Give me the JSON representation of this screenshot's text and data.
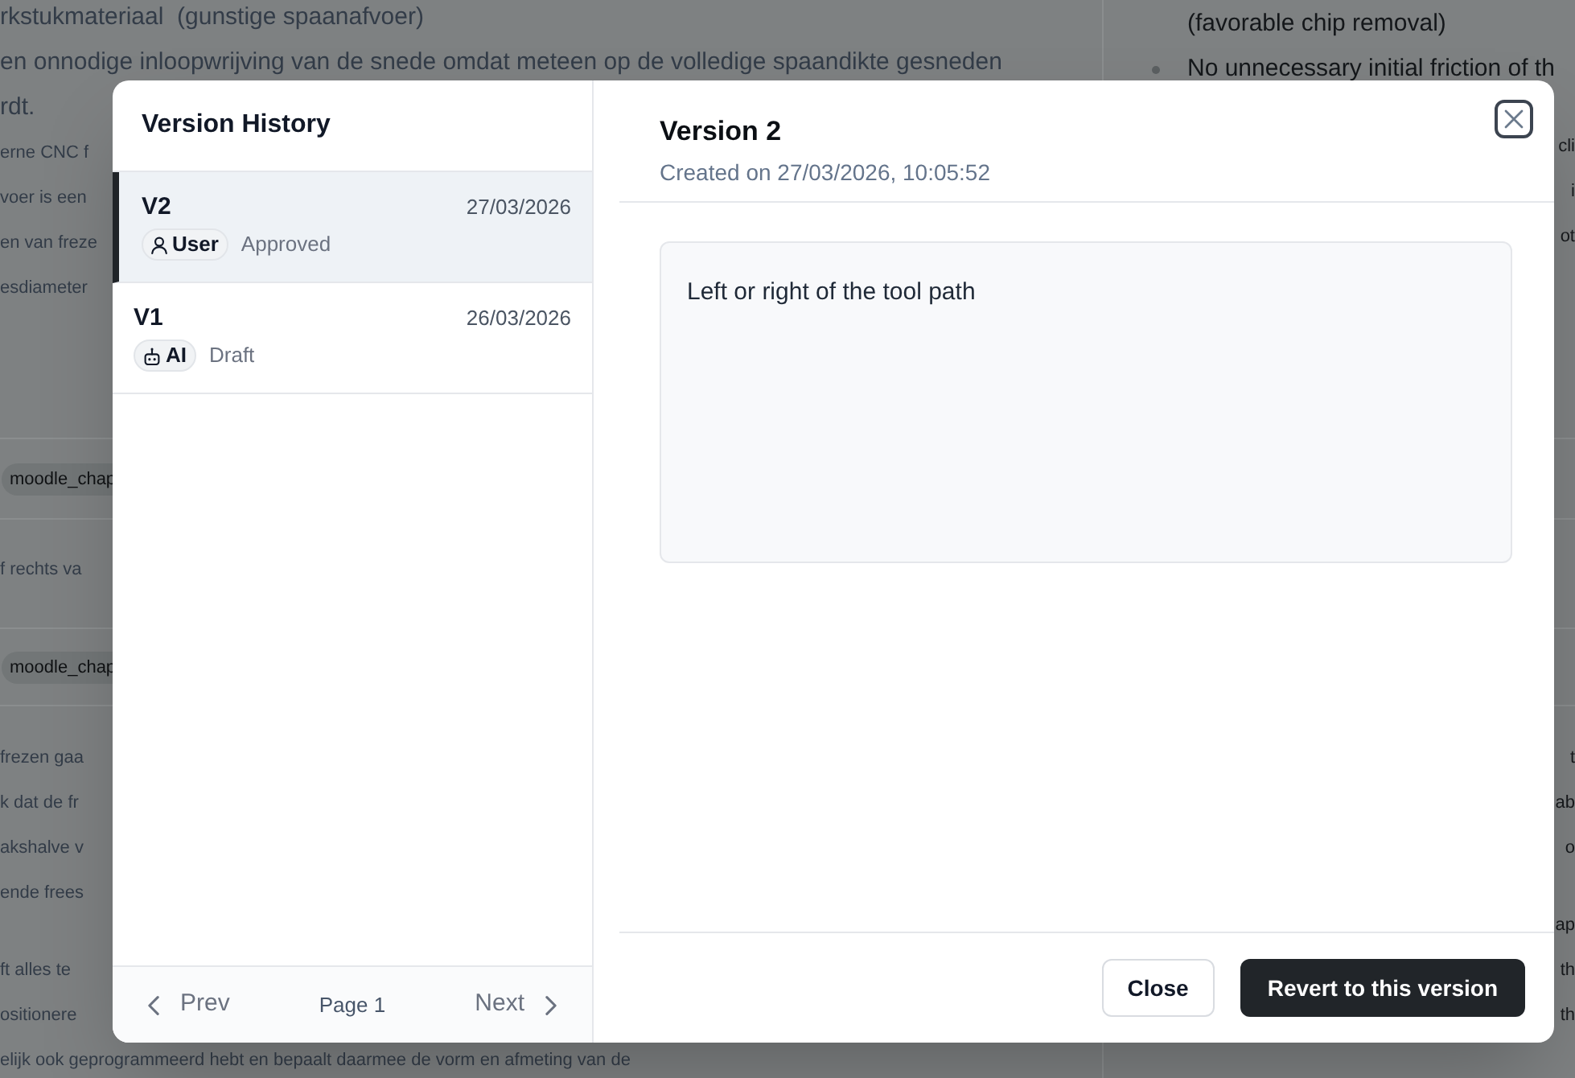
{
  "background": {
    "sections": [
      {
        "kind": "text",
        "left": [
          [
            "rkstukmateriaal  (gunstige spaanafvoer)",
            "en onnodige inloopwrijving van de snede omdat meteen op de volledige spaandikte gesneden",
            "rdt.",
            "erne CNC f",
            "voer is een",
            "en van freze",
            "esdiameter"
          ]
        ],
        "right": [
          {
            "kind": "list",
            "items": [
              {
                "text": "(favorable chip removal)",
                "bullet": false
              },
              {
                "text": "No unnecessary initial friction of th",
                "bullet": true
              }
            ]
          },
          {
            "kind": "edge",
            "lines": [
              "cli",
              "i",
              "ot"
            ]
          }
        ]
      },
      {
        "kind": "tag",
        "left": "moodle_chap"
      },
      {
        "kind": "text",
        "left": [
          [
            "f rechts va"
          ]
        ]
      },
      {
        "kind": "tag",
        "left": "moodle_chap"
      },
      {
        "kind": "text",
        "left": [
          [
            "frezen gaa",
            "k dat de fr",
            "akshalve v",
            "ende frees"
          ],
          [
            "ft alles te",
            "ositionere",
            "elijk ook geprogrammeerd hebt en bepaalt daarmee de vorm en afmeting van de"
          ]
        ],
        "right": [
          {
            "kind": "edge",
            "lines": [
              "t",
              "ab",
              "o"
            ]
          },
          {
            "kind": "edge",
            "lines": [
              "ap",
              "th",
              "th"
            ]
          }
        ]
      }
    ]
  },
  "dialog": {
    "sidebar": {
      "title": "Version History",
      "versions": [
        {
          "label": "V2",
          "date": "27/03/2026",
          "author": {
            "kind": "user",
            "label": "User"
          },
          "status": "Approved",
          "selected": true
        },
        {
          "label": "V1",
          "date": "26/03/2026",
          "author": {
            "kind": "ai",
            "label": "AI"
          },
          "status": "Draft",
          "selected": false
        }
      ],
      "pagination": {
        "prev": {
          "label": "Prev",
          "disabled": true
        },
        "page": "Page 1",
        "next": {
          "label": "Next",
          "disabled": true
        }
      }
    },
    "detail": {
      "title": "Version 2",
      "subtitle": "Created on 27/03/2026, 10:05:52",
      "content": "Left or right of the tool path",
      "buttons": [
        {
          "label": "Close",
          "kind": "secondary"
        },
        {
          "label": "Revert to this version",
          "kind": "primary"
        }
      ]
    }
  }
}
